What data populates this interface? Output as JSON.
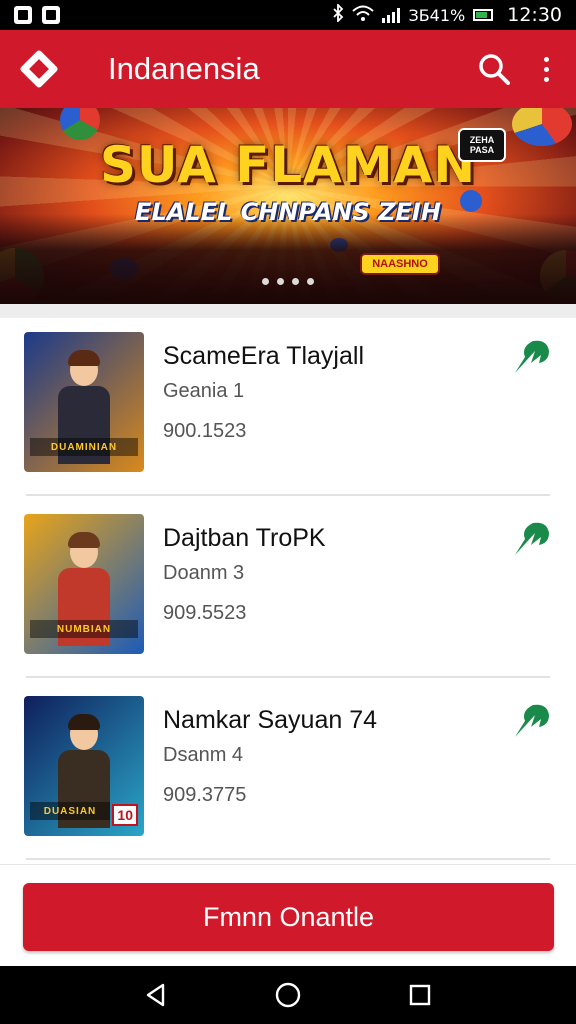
{
  "status_bar": {
    "network_text": "ЗБ41%",
    "time": "12:30",
    "icons": [
      "notification-icon",
      "notification-icon",
      "bluetooth-icon",
      "wifi-icon",
      "cell-signal-icon",
      "battery-icon"
    ]
  },
  "app_bar": {
    "title": "Indanensia",
    "icons": [
      "app-logo",
      "search-icon",
      "more-vert-icon"
    ]
  },
  "banner": {
    "title": "SUA FLAMAN",
    "subtitle": "ELALEL CHNPANS ZEIH",
    "badge_text": "ZEHA PASA",
    "mascot_label": "NAASHNO",
    "slide_count": 4
  },
  "games": [
    {
      "name": "ScameEra Tlayjall",
      "genre": "Geania 1",
      "count": "900.1523",
      "thumb_label": "DUAMINIAN",
      "thumb_tag": "",
      "thumb_colors": [
        "#1b3a8a",
        "#d98a1c"
      ]
    },
    {
      "name": "Dajtban TroPK",
      "genre": "Doanm 3",
      "count": "909.5523",
      "thumb_label": "NUMBIAN",
      "thumb_tag": "",
      "thumb_colors": [
        "#e8a41a",
        "#1d5bb8"
      ]
    },
    {
      "name": "Namkar Sayuan 74",
      "genre": "Dsanm 4",
      "count": "909.3775",
      "thumb_label": "DUASIAN",
      "thumb_tag": "10",
      "thumb_colors": [
        "#0f1f5c",
        "#2aa6c8"
      ]
    }
  ],
  "primary_button": {
    "label": "Fmnn Onantle"
  },
  "nav_bar": {
    "icons": [
      "back-icon",
      "home-icon",
      "recents-icon"
    ]
  },
  "colors": {
    "brand_red": "#d0192a",
    "download_green": "#1a8a4a"
  }
}
